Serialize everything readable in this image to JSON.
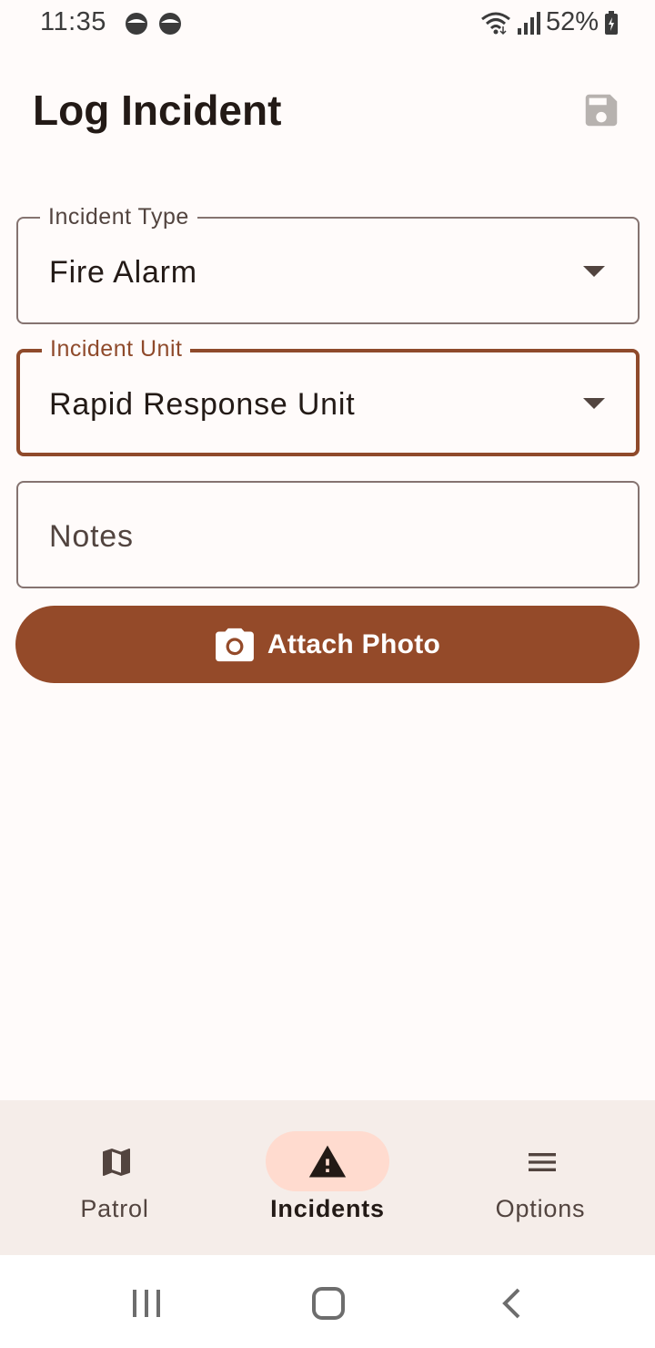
{
  "status_bar": {
    "time": "11:35",
    "battery": "52%",
    "notification_icons": [
      "circle-notification-icon",
      "circle-notification-icon"
    ]
  },
  "app_bar": {
    "title": "Log Incident",
    "save_icon": "save-icon"
  },
  "form": {
    "incident_type": {
      "label": "Incident Type",
      "value": "Fire Alarm"
    },
    "incident_unit": {
      "label": "Incident Unit",
      "value": "Rapid Response Unit"
    },
    "notes": {
      "placeholder": "Notes",
      "value": ""
    },
    "attach_photo": {
      "label": "Attach Photo",
      "icon": "camera-icon"
    }
  },
  "bottom_nav": {
    "items": [
      {
        "label": "Patrol",
        "icon": "map-icon",
        "active": false
      },
      {
        "label": "Incidents",
        "icon": "warning-icon",
        "active": true
      },
      {
        "label": "Options",
        "icon": "menu-icon",
        "active": false
      }
    ]
  },
  "colors": {
    "primary": "#944a29",
    "focused_outline": "#8f4a2b",
    "active_indicator": "#ffdbcf",
    "nav_background": "#f5ede9",
    "background": "#fffbfa"
  }
}
